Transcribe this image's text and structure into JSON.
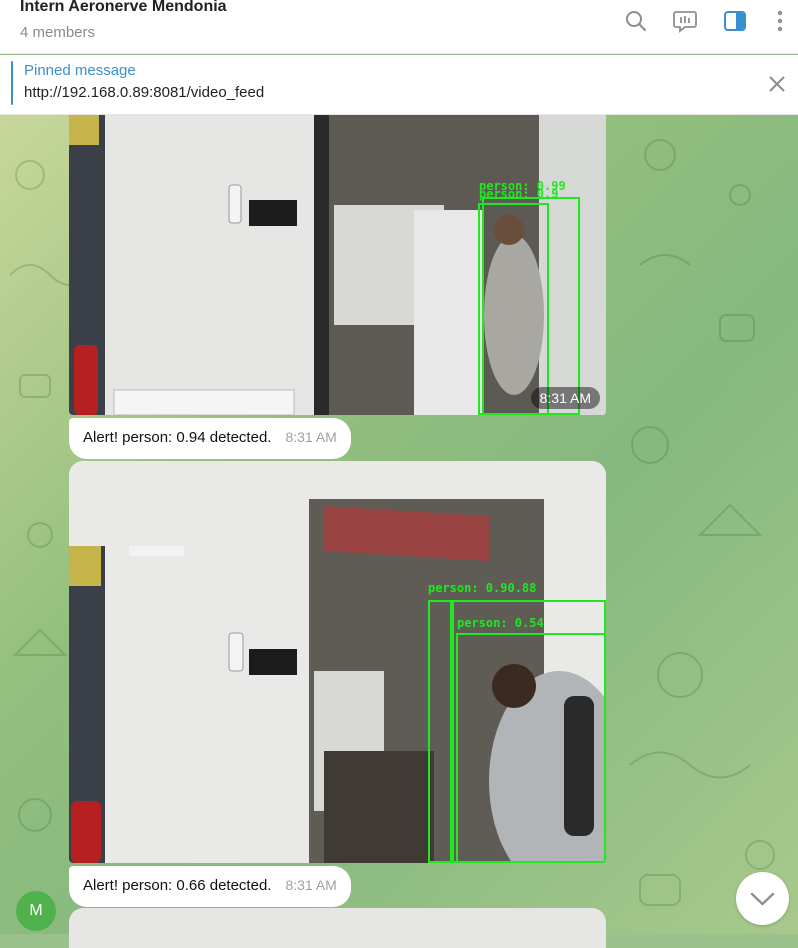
{
  "header": {
    "title": "Intern Aeronerve Mendonia",
    "subtitle": "4 members",
    "icons": [
      "search-icon",
      "topics-icon",
      "sidebar-toggle-icon",
      "more-vertical-icon"
    ]
  },
  "pinned": {
    "title": "Pinned message",
    "text": "http://192.168.0.89:8081/video_feed"
  },
  "messages": [
    {
      "photo_time": "8:31 AM",
      "detections": [
        "person: 0.99",
        "person: 0.9"
      ],
      "caption": "Alert! person: 0.94 detected.",
      "time": "8:31 AM"
    },
    {
      "detections": [
        "person: 0.90.88",
        "person: 0.54"
      ],
      "caption": "Alert! person: 0.66 detected.",
      "time": "8:31 AM"
    }
  ],
  "avatar": {
    "initial": "M",
    "color": "#4fb24d"
  },
  "colors": {
    "accent": "#3a8fd1",
    "detection": "#22e622"
  }
}
